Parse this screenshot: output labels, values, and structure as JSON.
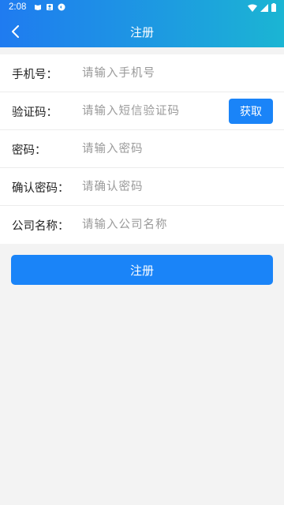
{
  "status_bar": {
    "time": "2:08",
    "left_icons": [
      "book-icon",
      "contacts-icon",
      "sync-icon"
    ],
    "right_icons": [
      "wifi-icon",
      "signal-icon",
      "battery-icon"
    ]
  },
  "app_bar": {
    "title": "注册",
    "back_icon": "chevron-left-icon"
  },
  "form": {
    "rows": [
      {
        "label": "手机号：",
        "placeholder": "请输入手机号",
        "value": ""
      },
      {
        "label": "验证码：",
        "placeholder": "请输入短信验证码",
        "value": ""
      },
      {
        "label": "密码：",
        "placeholder": "请输入密码",
        "value": ""
      },
      {
        "label": "确认密码：",
        "placeholder": "请确认密码",
        "value": ""
      },
      {
        "label": "公司名称：",
        "placeholder": "请输入公司名称",
        "value": ""
      }
    ],
    "get_code_label": "获取"
  },
  "submit": {
    "label": "注册"
  },
  "colors": {
    "accent": "#1a84f8",
    "header_start": "#1f7bf0",
    "header_end": "#1bb5d3",
    "page_bg": "#f3f3f3"
  }
}
